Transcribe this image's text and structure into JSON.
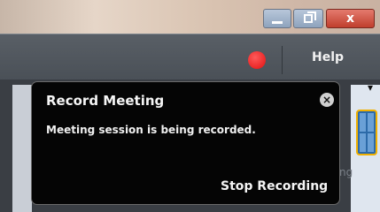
{
  "window": {
    "title_bar": {
      "buttons": {
        "minimize": "minimize-icon",
        "maximize": "maximize-icon",
        "close": "close-icon",
        "close_glyph": "x"
      }
    }
  },
  "menubar": {
    "recording_indicator": {
      "icon": "recording-dot-icon",
      "color": "#e11010"
    },
    "help_label": "Help"
  },
  "side_panel": {
    "partial_label": "ng"
  },
  "record_popup": {
    "title": "Record Meeting",
    "close_glyph": "×",
    "message": "Meeting session is being recorded.",
    "stop_button_label": "Stop Recording"
  }
}
